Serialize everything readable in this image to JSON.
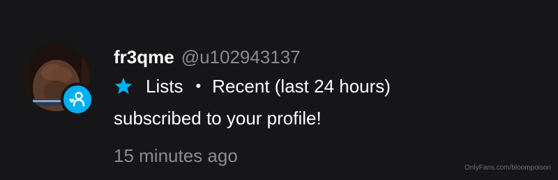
{
  "notification": {
    "display_name": "fr3qme",
    "username": "@u102943137",
    "list_label": "Lists",
    "separator": "•",
    "recent_label": "Recent (last 24 hours)",
    "message": "subscribed to your profile!",
    "time_ago": "15 minutes ago",
    "badge_icon": "user-heart-icon",
    "star_icon": "star-icon",
    "colors": {
      "accent": "#00aff0",
      "background": "#161618",
      "muted_text": "#8a8c8f"
    }
  },
  "watermark": "OnlyFans.com/bloompoison"
}
